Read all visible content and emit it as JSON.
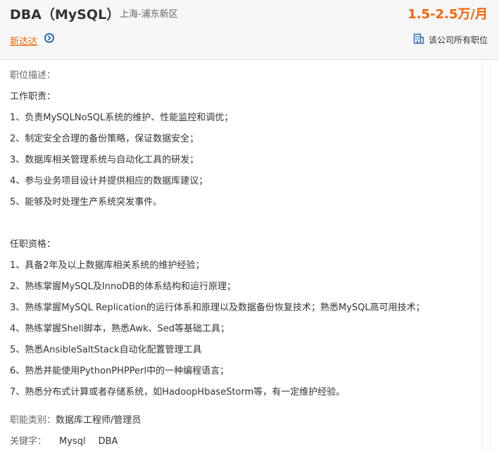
{
  "header": {
    "title": "DBA（MySQL）",
    "location": "上海-浦东新区",
    "salary": "1.5-2.5万/月",
    "company": "新达达",
    "all_jobs": "该公司所有职位"
  },
  "description": {
    "heading": "职位描述：",
    "duties_heading": "工作职责：",
    "duties": [
      "1、负责MySQLNoSQL系统的维护、性能监控和调优；",
      "2、制定安全合理的备份策略，保证数据安全；",
      "3、数据库相关管理系统与自动化工具的研发；",
      "4、参与业务项目设计并提供相应的数据库建议；",
      "5、能够及时处理生产系统突发事件。"
    ],
    "requirements_heading": "任职资格：",
    "requirements": [
      "1、具备2年及以上数据库相关系统的维护经验；",
      "2、熟练掌握MySQL及InnoDB的体系结构和运行原理；",
      "3、熟练掌握MySQL Replication的运行体系和原理以及数据备份恢复技术；熟悉MySQL高可用技术；",
      "4、熟练掌握Shell脚本，熟悉Awk、Sed等基础工具；",
      "5、熟悉AnsibleSaltStack自动化配置管理工具",
      "6、熟悉并能使用PythonPHPPerl中的一种编程语言；",
      "7、熟悉分布式计算或者存储系统，如HadoopHbaseStorm等，有一定维护经验。"
    ],
    "category_label": "职能类别：",
    "category_value": "数据库工程师/管理员",
    "keywords_label": "关键字：",
    "keywords": [
      "Mysql",
      "DBA"
    ]
  },
  "colors": {
    "accent_orange": "#ff6000",
    "icon_blue": "#2b6ebd"
  }
}
